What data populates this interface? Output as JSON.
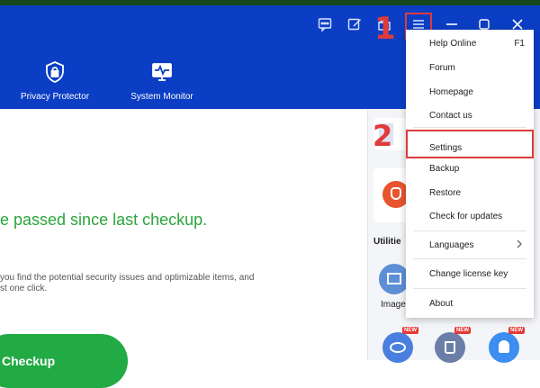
{
  "titlebar": {
    "icons": [
      "chat-icon",
      "edit-icon",
      "gift-icon",
      "menu-icon",
      "minimize-icon",
      "maximize-icon",
      "close-icon"
    ],
    "step1": "1",
    "step2": "2"
  },
  "nav": [
    {
      "label": "Privacy Protector",
      "icon": "shield-lock-icon"
    },
    {
      "label": "System Monitor",
      "icon": "monitor-pulse-icon"
    }
  ],
  "main": {
    "status": "e passed since last checkup.",
    "desc_line1": "you find the potential security issues and optimizable items, and",
    "desc_line2": "st one click.",
    "checkup_button": "Checkup"
  },
  "sidebar": {
    "utilities_title": "Utilitie",
    "image_label": "Image",
    "new_badge": "NEW"
  },
  "menu": {
    "items": [
      {
        "label": "Help Online",
        "shortcut": "F1"
      },
      {
        "label": "Forum"
      },
      {
        "label": "Homepage"
      },
      {
        "label": "Contact us"
      },
      {
        "label": "Settings"
      },
      {
        "label": "Backup"
      },
      {
        "label": "Restore"
      },
      {
        "label": "Check for updates"
      },
      {
        "label": "Languages"
      },
      {
        "label": "Change license key"
      },
      {
        "label": "About"
      }
    ]
  },
  "colors": {
    "titlebar": "#0b3ec4",
    "accent_green": "#22aa44",
    "highlight_red": "#e03a3a"
  }
}
